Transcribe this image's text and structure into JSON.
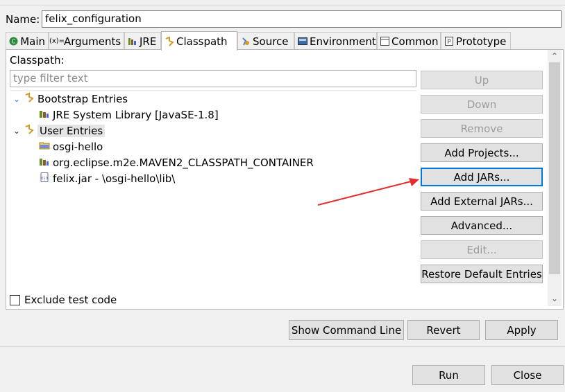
{
  "name": {
    "label": "Name:",
    "value": "felix_configuration"
  },
  "tabs": [
    {
      "label": "Main",
      "icon": "main-tab-icon"
    },
    {
      "label": "Arguments",
      "icon": "arguments-icon"
    },
    {
      "label": "JRE",
      "icon": "jre-icon"
    },
    {
      "label": "Classpath",
      "icon": "classpath-icon",
      "active": true
    },
    {
      "label": "Source",
      "icon": "source-icon"
    },
    {
      "label": "Environment",
      "icon": "environment-icon"
    },
    {
      "label": "Common",
      "icon": "common-icon"
    },
    {
      "label": "Prototype",
      "icon": "prototype-icon"
    }
  ],
  "classpath": {
    "label": "Classpath:",
    "filter_placeholder": "type filter text",
    "tree": {
      "bootstrap": {
        "label": "Bootstrap Entries",
        "children": [
          "JRE System Library [JavaSE-1.8]"
        ]
      },
      "user": {
        "label": "User Entries",
        "children": [
          "osgi-hello",
          "org.eclipse.m2e.MAVEN2_CLASSPATH_CONTAINER",
          "felix.jar - \\osgi-hello\\lib\\"
        ]
      }
    },
    "buttons": {
      "up": "Up",
      "down": "Down",
      "remove": "Remove",
      "add_projects": "Add Projects...",
      "add_jars": "Add JARs...",
      "add_external_jars": "Add External JARs...",
      "advanced": "Advanced...",
      "edit": "Edit...",
      "restore": "Restore Default Entries"
    },
    "exclude_test_code": "Exclude test code"
  },
  "actions": {
    "show_command_line": "Show Command Line",
    "revert": "Revert",
    "apply": "Apply",
    "run": "Run",
    "close": "Close"
  },
  "colors": {
    "annotation_arrow": "#e03030",
    "focus": "#0078d7",
    "tree_twisty": "#3b7ad0"
  }
}
